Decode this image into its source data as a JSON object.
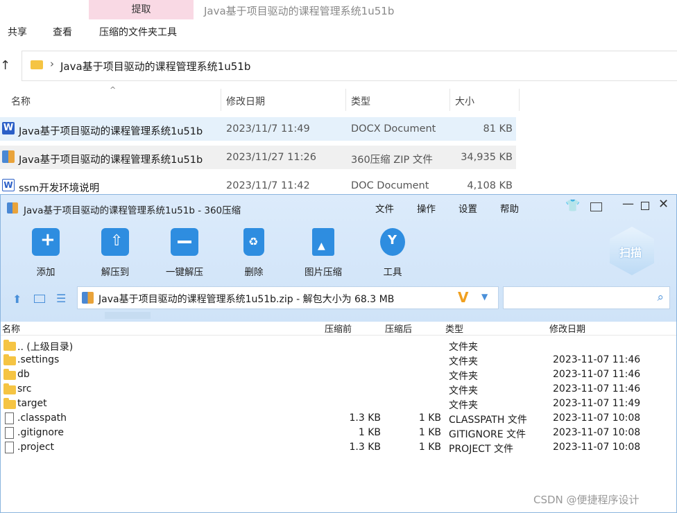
{
  "explorer": {
    "ribbon": {
      "context_tab": "提取",
      "title": "Java基于项目驱动的课程管理系统1u51b",
      "menu": [
        "共享",
        "查看",
        "压缩的文件夹工具"
      ]
    },
    "address": {
      "path": "Java基于项目驱动的课程管理系统1u51b"
    },
    "columns": [
      "名称",
      "修改日期",
      "类型",
      "大小"
    ],
    "files": [
      {
        "name": "Java基于项目驱动的课程管理系统1u51b",
        "date": "2023/11/7 11:49",
        "type": "DOCX Document",
        "size": "81 KB",
        "icon": "word-icon"
      },
      {
        "name": "Java基于项目驱动的课程管理系统1u51b",
        "date": "2023/11/27 11:26",
        "type": "360压缩 ZIP 文件",
        "size": "34,935 KB",
        "icon": "zip-icon"
      },
      {
        "name": "ssm开发环境说明",
        "date": "2023/11/7 11:42",
        "type": "DOC Document",
        "size": "4,108 KB",
        "icon": "word-doc-icon"
      }
    ]
  },
  "zip_app": {
    "title": "Java基于项目驱动的课程管理系统1u51b - 360压缩",
    "menu": [
      "文件",
      "操作",
      "设置",
      "帮助"
    ],
    "toolbar": [
      {
        "label": "添加",
        "icon": "add-icon"
      },
      {
        "label": "解压到",
        "icon": "extract-to-icon"
      },
      {
        "label": "一键解压",
        "icon": "one-click-extract-icon"
      },
      {
        "label": "删除",
        "icon": "delete-icon"
      },
      {
        "label": "图片压缩",
        "icon": "image-compress-icon"
      },
      {
        "label": "工具",
        "icon": "tools-icon"
      }
    ],
    "scan_label": "扫描",
    "path_text": "Java基于项目驱动的课程管理系统1u51b.zip - 解包大小为 68.3 MB",
    "columns": [
      "名称",
      "压缩前",
      "压缩后",
      "类型",
      "修改日期"
    ],
    "rows": [
      {
        "name": ".. (上级目录)",
        "before": "",
        "after": "",
        "type": "文件夹",
        "date": "",
        "icon": "folder-icon"
      },
      {
        "name": ".settings",
        "before": "",
        "after": "",
        "type": "文件夹",
        "date": "2023-11-07 11:46",
        "icon": "folder-icon"
      },
      {
        "name": "db",
        "before": "",
        "after": "",
        "type": "文件夹",
        "date": "2023-11-07 11:46",
        "icon": "folder-icon"
      },
      {
        "name": "src",
        "before": "",
        "after": "",
        "type": "文件夹",
        "date": "2023-11-07 11:46",
        "icon": "folder-icon"
      },
      {
        "name": "target",
        "before": "",
        "after": "",
        "type": "文件夹",
        "date": "2023-11-07 11:49",
        "icon": "folder-icon"
      },
      {
        "name": ".classpath",
        "before": "1.3 KB",
        "after": "1 KB",
        "type": "CLASSPATH 文件",
        "date": "2023-11-07 10:08",
        "icon": "file-icon"
      },
      {
        "name": ".gitignore",
        "before": "1 KB",
        "after": "1 KB",
        "type": "GITIGNORE 文件",
        "date": "2023-11-07 10:08",
        "icon": "file-icon"
      },
      {
        "name": ".project",
        "before": "1.3 KB",
        "after": "1 KB",
        "type": "PROJECT 文件",
        "date": "2023-11-07 10:08",
        "icon": "file-icon"
      }
    ]
  },
  "watermark": "CSDN @便捷程序设计",
  "colors": {
    "accent": "#2b8ce6",
    "selected_row": "#e5f1fb",
    "hover_row": "#f0f0f0"
  }
}
